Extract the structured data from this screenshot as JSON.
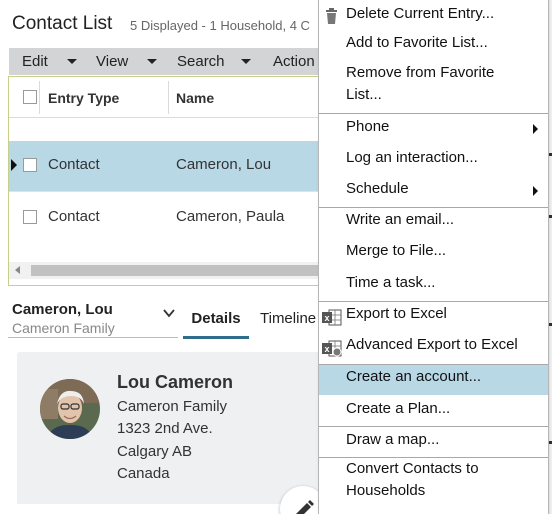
{
  "header": {
    "title": "Contact List",
    "subtitle": "5 Displayed - 1 Household, 4 C"
  },
  "menubar": {
    "items": [
      {
        "label": "Edit"
      },
      {
        "label": "View"
      },
      {
        "label": "Search"
      },
      {
        "label": "Action"
      }
    ]
  },
  "grid": {
    "columns": [
      "Entry Type",
      "Name"
    ],
    "rows": [
      {
        "type": "Contact",
        "name": "Cameron, Lou",
        "selected": true
      },
      {
        "type": "Contact",
        "name": "Cameron, Paula",
        "selected": false
      }
    ]
  },
  "detail": {
    "name": "Cameron, Lou",
    "family": "Cameron Family",
    "tabs": [
      {
        "label": "Details",
        "active": true
      },
      {
        "label": "Timeline",
        "active": false
      }
    ]
  },
  "card": {
    "name": "Lou Cameron",
    "lines": [
      "Cameron Family",
      "1323 2nd Ave.",
      "Calgary AB",
      "Canada"
    ]
  },
  "context_menu": {
    "items": [
      {
        "label": "Delete Current Entry...",
        "icon": "trash-icon"
      },
      {
        "label": "Add to Favorite List..."
      },
      {
        "label": "Remove from Favorite\nList..."
      },
      {
        "label": "Phone",
        "submenu": true
      },
      {
        "label": "Log an interaction..."
      },
      {
        "label": "Schedule",
        "submenu": true
      },
      {
        "label": "Write an email..."
      },
      {
        "label": "Merge to File..."
      },
      {
        "label": "Time a task..."
      },
      {
        "label": "Export to Excel",
        "icon": "excel-icon"
      },
      {
        "label": "Advanced Export to Excel",
        "icon": "excel-advanced-icon"
      },
      {
        "label": "Create an account...",
        "highlighted": true
      },
      {
        "label": "Create a Plan..."
      },
      {
        "label": "Draw a map..."
      },
      {
        "label": "Convert Contacts to\nHouseholds"
      }
    ]
  },
  "colors": {
    "selection": "#b8d8e6",
    "menubar": "#d2d4d6",
    "active_tab": "#2f6d8a",
    "card": "#eef0f1"
  }
}
